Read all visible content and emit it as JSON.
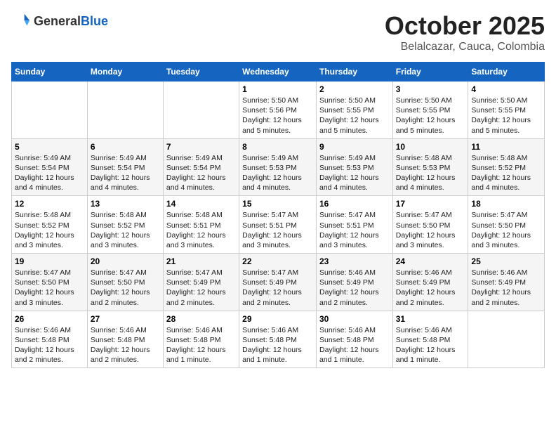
{
  "header": {
    "logo_general": "General",
    "logo_blue": "Blue",
    "month_title": "October 2025",
    "location": "Belalcazar, Cauca, Colombia"
  },
  "days_of_week": [
    "Sunday",
    "Monday",
    "Tuesday",
    "Wednesday",
    "Thursday",
    "Friday",
    "Saturday"
  ],
  "weeks": [
    [
      {
        "day": "",
        "info": ""
      },
      {
        "day": "",
        "info": ""
      },
      {
        "day": "",
        "info": ""
      },
      {
        "day": "1",
        "info": "Sunrise: 5:50 AM\nSunset: 5:56 PM\nDaylight: 12 hours\nand 5 minutes."
      },
      {
        "day": "2",
        "info": "Sunrise: 5:50 AM\nSunset: 5:55 PM\nDaylight: 12 hours\nand 5 minutes."
      },
      {
        "day": "3",
        "info": "Sunrise: 5:50 AM\nSunset: 5:55 PM\nDaylight: 12 hours\nand 5 minutes."
      },
      {
        "day": "4",
        "info": "Sunrise: 5:50 AM\nSunset: 5:55 PM\nDaylight: 12 hours\nand 5 minutes."
      }
    ],
    [
      {
        "day": "5",
        "info": "Sunrise: 5:49 AM\nSunset: 5:54 PM\nDaylight: 12 hours\nand 4 minutes."
      },
      {
        "day": "6",
        "info": "Sunrise: 5:49 AM\nSunset: 5:54 PM\nDaylight: 12 hours\nand 4 minutes."
      },
      {
        "day": "7",
        "info": "Sunrise: 5:49 AM\nSunset: 5:54 PM\nDaylight: 12 hours\nand 4 minutes."
      },
      {
        "day": "8",
        "info": "Sunrise: 5:49 AM\nSunset: 5:53 PM\nDaylight: 12 hours\nand 4 minutes."
      },
      {
        "day": "9",
        "info": "Sunrise: 5:49 AM\nSunset: 5:53 PM\nDaylight: 12 hours\nand 4 minutes."
      },
      {
        "day": "10",
        "info": "Sunrise: 5:48 AM\nSunset: 5:53 PM\nDaylight: 12 hours\nand 4 minutes."
      },
      {
        "day": "11",
        "info": "Sunrise: 5:48 AM\nSunset: 5:52 PM\nDaylight: 12 hours\nand 4 minutes."
      }
    ],
    [
      {
        "day": "12",
        "info": "Sunrise: 5:48 AM\nSunset: 5:52 PM\nDaylight: 12 hours\nand 3 minutes."
      },
      {
        "day": "13",
        "info": "Sunrise: 5:48 AM\nSunset: 5:52 PM\nDaylight: 12 hours\nand 3 minutes."
      },
      {
        "day": "14",
        "info": "Sunrise: 5:48 AM\nSunset: 5:51 PM\nDaylight: 12 hours\nand 3 minutes."
      },
      {
        "day": "15",
        "info": "Sunrise: 5:47 AM\nSunset: 5:51 PM\nDaylight: 12 hours\nand 3 minutes."
      },
      {
        "day": "16",
        "info": "Sunrise: 5:47 AM\nSunset: 5:51 PM\nDaylight: 12 hours\nand 3 minutes."
      },
      {
        "day": "17",
        "info": "Sunrise: 5:47 AM\nSunset: 5:50 PM\nDaylight: 12 hours\nand 3 minutes."
      },
      {
        "day": "18",
        "info": "Sunrise: 5:47 AM\nSunset: 5:50 PM\nDaylight: 12 hours\nand 3 minutes."
      }
    ],
    [
      {
        "day": "19",
        "info": "Sunrise: 5:47 AM\nSunset: 5:50 PM\nDaylight: 12 hours\nand 3 minutes."
      },
      {
        "day": "20",
        "info": "Sunrise: 5:47 AM\nSunset: 5:50 PM\nDaylight: 12 hours\nand 2 minutes."
      },
      {
        "day": "21",
        "info": "Sunrise: 5:47 AM\nSunset: 5:49 PM\nDaylight: 12 hours\nand 2 minutes."
      },
      {
        "day": "22",
        "info": "Sunrise: 5:47 AM\nSunset: 5:49 PM\nDaylight: 12 hours\nand 2 minutes."
      },
      {
        "day": "23",
        "info": "Sunrise: 5:46 AM\nSunset: 5:49 PM\nDaylight: 12 hours\nand 2 minutes."
      },
      {
        "day": "24",
        "info": "Sunrise: 5:46 AM\nSunset: 5:49 PM\nDaylight: 12 hours\nand 2 minutes."
      },
      {
        "day": "25",
        "info": "Sunrise: 5:46 AM\nSunset: 5:49 PM\nDaylight: 12 hours\nand 2 minutes."
      }
    ],
    [
      {
        "day": "26",
        "info": "Sunrise: 5:46 AM\nSunset: 5:48 PM\nDaylight: 12 hours\nand 2 minutes."
      },
      {
        "day": "27",
        "info": "Sunrise: 5:46 AM\nSunset: 5:48 PM\nDaylight: 12 hours\nand 2 minutes."
      },
      {
        "day": "28",
        "info": "Sunrise: 5:46 AM\nSunset: 5:48 PM\nDaylight: 12 hours\nand 1 minute."
      },
      {
        "day": "29",
        "info": "Sunrise: 5:46 AM\nSunset: 5:48 PM\nDaylight: 12 hours\nand 1 minute."
      },
      {
        "day": "30",
        "info": "Sunrise: 5:46 AM\nSunset: 5:48 PM\nDaylight: 12 hours\nand 1 minute."
      },
      {
        "day": "31",
        "info": "Sunrise: 5:46 AM\nSunset: 5:48 PM\nDaylight: 12 hours\nand 1 minute."
      },
      {
        "day": "",
        "info": ""
      }
    ]
  ]
}
